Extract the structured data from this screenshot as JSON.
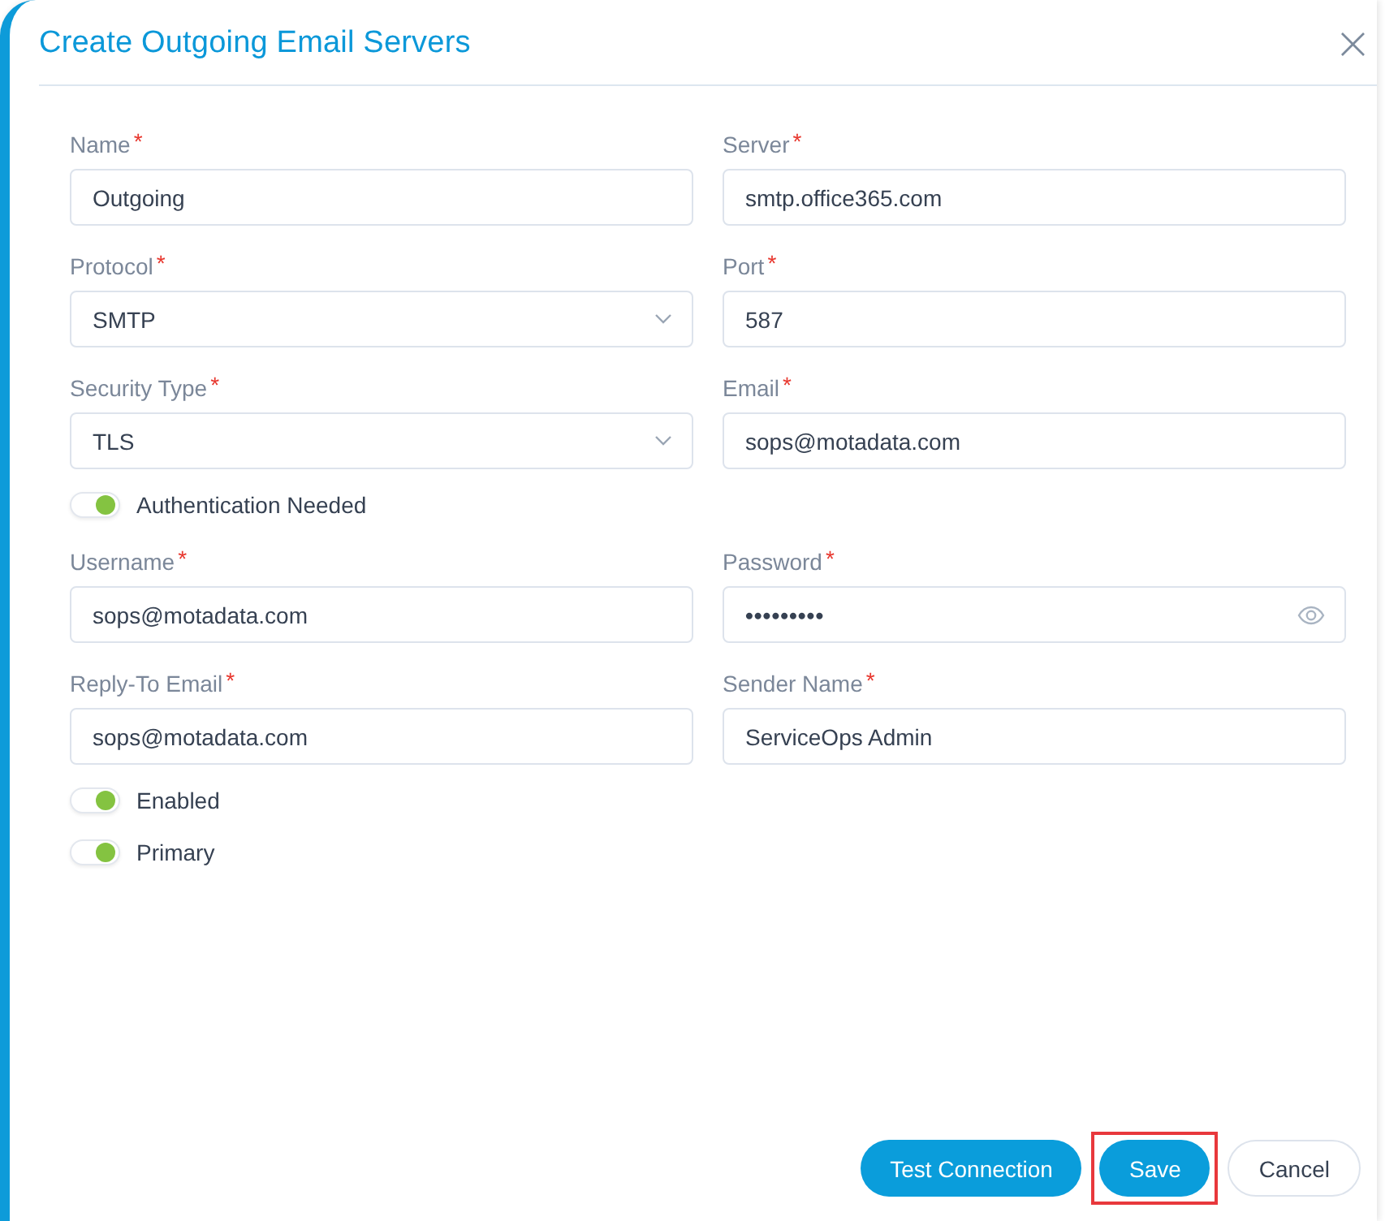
{
  "dialog": {
    "title": "Create Outgoing Email Servers",
    "close": "×"
  },
  "rows": [
    {
      "kind": "fields",
      "fields": [
        {
          "kind": "text",
          "label": "Name",
          "required_mark": "*",
          "value": "Outgoing"
        },
        {
          "kind": "text",
          "label": "Server",
          "required_mark": "*",
          "value": "smtp.office365.com"
        }
      ]
    },
    {
      "kind": "fields",
      "fields": [
        {
          "kind": "select",
          "label": "Protocol",
          "required_mark": "*",
          "value": "SMTP"
        },
        {
          "kind": "text",
          "label": "Port",
          "required_mark": "*",
          "value": "587"
        }
      ]
    },
    {
      "kind": "fields",
      "fields": [
        {
          "kind": "select",
          "label": "Security Type",
          "required_mark": "*",
          "value": "TLS"
        },
        {
          "kind": "text",
          "label": "Email",
          "required_mark": "*",
          "value": "sops@motadata.com"
        }
      ]
    },
    {
      "kind": "toggle",
      "label": "Authentication Needed",
      "on": true
    },
    {
      "kind": "fields",
      "fields": [
        {
          "kind": "text",
          "label": "Username",
          "required_mark": "*",
          "value": "sops@motadata.com"
        },
        {
          "kind": "password",
          "label": "Password",
          "required_mark": "*",
          "value": "•••••••••"
        }
      ]
    },
    {
      "kind": "fields",
      "fields": [
        {
          "kind": "text",
          "label": "Reply-To Email",
          "required_mark": "*",
          "value": "sops@motadata.com"
        },
        {
          "kind": "text",
          "label": "Sender Name",
          "required_mark": "*",
          "value": "ServiceOps Admin"
        }
      ]
    },
    {
      "kind": "toggle",
      "label": "Enabled",
      "on": true
    },
    {
      "kind": "toggle",
      "label": "Primary",
      "on": true
    }
  ],
  "buttons": [
    {
      "kind": "primary",
      "label": "Test Connection",
      "highlighted": false
    },
    {
      "kind": "primary",
      "label": "Save",
      "highlighted": true
    },
    {
      "kind": "secondary",
      "label": "Cancel",
      "highlighted": false
    }
  ]
}
